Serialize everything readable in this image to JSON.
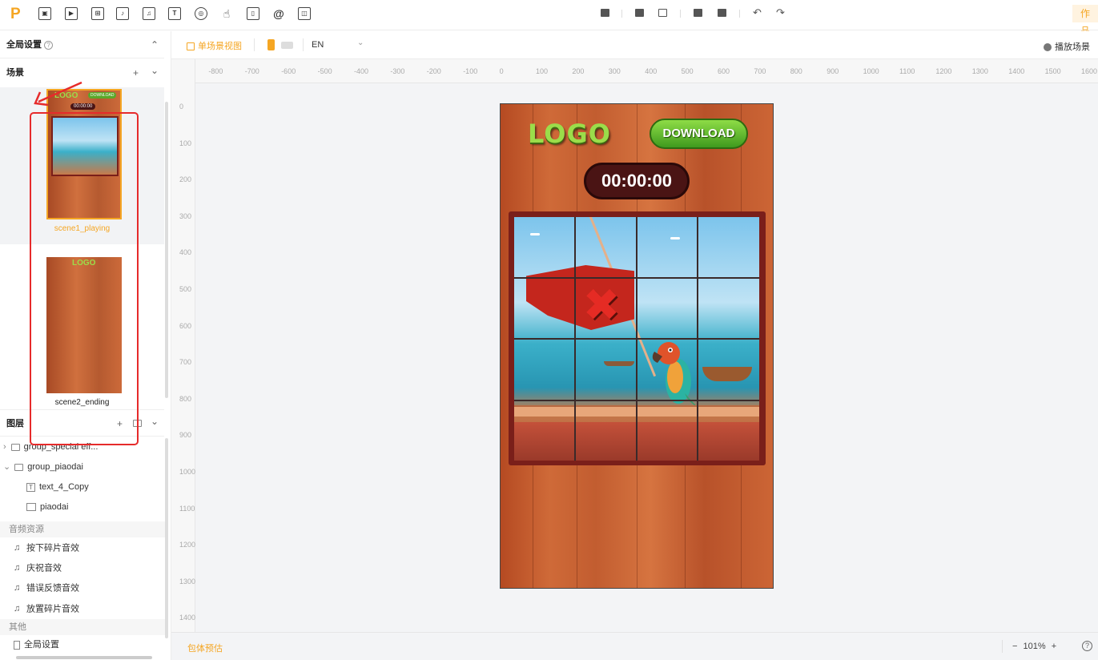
{
  "toolbar": {
    "logo_letter": "P",
    "tools": [
      "image-icon",
      "video-icon",
      "spritesheet-icon",
      "note-icon",
      "music-icon",
      "text-icon",
      "effect-icon",
      "gesture-icon",
      "phone-icon",
      "at-icon",
      "layout-icon"
    ],
    "works_label": "作品"
  },
  "left": {
    "global_settings": "全局设置",
    "help_mark": "?",
    "scenes_title": "场景",
    "add": "+",
    "collapse": "⌄",
    "scenes": [
      {
        "name": "scene1_playing",
        "selected": true,
        "thumb_logo": "LOGO",
        "thumb_download": "DOWNLOAD",
        "thumb_timer": "00:00:00"
      },
      {
        "name": "scene2_ending",
        "selected": false,
        "thumb_logo": "LOGO"
      }
    ],
    "layers_title": "图层",
    "layers": [
      {
        "label": "group_special eff...",
        "type": "folder",
        "expanded": false
      },
      {
        "label": "group_piaodai",
        "type": "folder",
        "expanded": true
      },
      {
        "label": "text_4_Copy",
        "type": "text"
      },
      {
        "label": "piaodai",
        "type": "image"
      }
    ],
    "audio_group": "音频资源",
    "audio": [
      "按下碎片音效",
      "庆祝音效",
      "错误反馈音效",
      "放置碎片音效"
    ],
    "other_group": "其他",
    "other": [
      "全局设置"
    ]
  },
  "subbar": {
    "single_scene_view": "单场景视图",
    "language": "EN",
    "play_scene": "播放场景"
  },
  "ruler": {
    "h": [
      "-900",
      "-800",
      "-700",
      "-600",
      "-500",
      "-400",
      "-300",
      "-200",
      "-100",
      "0",
      "100",
      "200",
      "300",
      "400",
      "500",
      "600",
      "700",
      "800",
      "900",
      "1000",
      "1100",
      "1200",
      "1300",
      "1400",
      "1500",
      "1600"
    ],
    "v": [
      "0",
      "100",
      "200",
      "300",
      "400",
      "500",
      "600",
      "700",
      "800",
      "900",
      "1000",
      "1100",
      "1200",
      "1300",
      "1400"
    ]
  },
  "canvas": {
    "logo": "LOGO",
    "download": "DOWNLOAD",
    "timer": "00:00:00"
  },
  "bottom": {
    "package_estimate": "包体预估",
    "zoom_minus": "−",
    "zoom": "101%",
    "zoom_plus": "+",
    "help": "?"
  },
  "colors": {
    "accent": "#f5a623",
    "highlight": "#e62b2b"
  }
}
